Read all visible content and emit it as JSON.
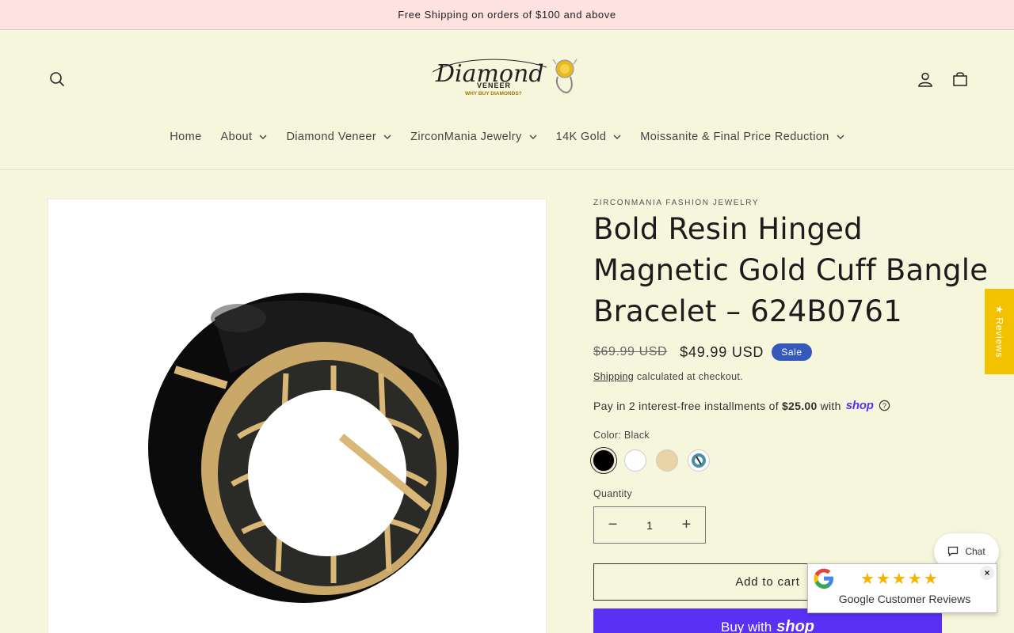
{
  "announcement": "Free Shipping on orders of $100 and above",
  "logo": {
    "word": "Diamond",
    "sub": "VENEER",
    "tagline": "WHY BUY DIAMONDS?"
  },
  "nav": [
    {
      "label": "Home",
      "has_dropdown": false
    },
    {
      "label": "About",
      "has_dropdown": true
    },
    {
      "label": "Diamond Veneer",
      "has_dropdown": true
    },
    {
      "label": "ZirconMania Jewelry",
      "has_dropdown": true
    },
    {
      "label": "14K Gold",
      "has_dropdown": true
    },
    {
      "label": "Moissanite & Final Price Reduction",
      "has_dropdown": true
    }
  ],
  "product": {
    "vendor": "ZIRCONMANIA FASHION JEWELRY",
    "title": "Bold Resin Hinged Magnetic Gold Cuff Bangle Bracelet – 624B0761",
    "price_old": "$69.99 USD",
    "price_new": "$49.99 USD",
    "sale_badge": "Sale",
    "shipping_link": "Shipping",
    "shipping_rest": " calculated at checkout.",
    "installments_prefix": "Pay in 2 interest-free installments of",
    "installments_amount": "$25.00",
    "installments_with": "with",
    "shop_word": "shop",
    "color_label": "Color: Black",
    "swatches": [
      {
        "name": "Black",
        "color": "#000000",
        "selected": true
      },
      {
        "name": "White",
        "color": "#ffffff",
        "selected": false
      },
      {
        "name": "Beige",
        "color": "#e8d4a5",
        "selected": false
      },
      {
        "name": "Turquoise",
        "color": "#4a8fa8",
        "selected": false
      }
    ],
    "quantity_label": "Quantity",
    "quantity_value": "1",
    "add_to_cart": "Add to cart",
    "buy_with": "Buy with",
    "buy_shop": "shop"
  },
  "widgets": {
    "reviews_tab": "★ Reviews",
    "chat": "Chat",
    "google_stars": "★★★★★",
    "google_text": "Google Customer Reviews",
    "google_close": "×"
  },
  "colors": {
    "background": "#f5f6dc",
    "announcement_bg": "#fde2e0",
    "sale_badge": "#3559b9",
    "shop_purple": "#5a31f4",
    "reviews_tab": "#f2c200"
  }
}
